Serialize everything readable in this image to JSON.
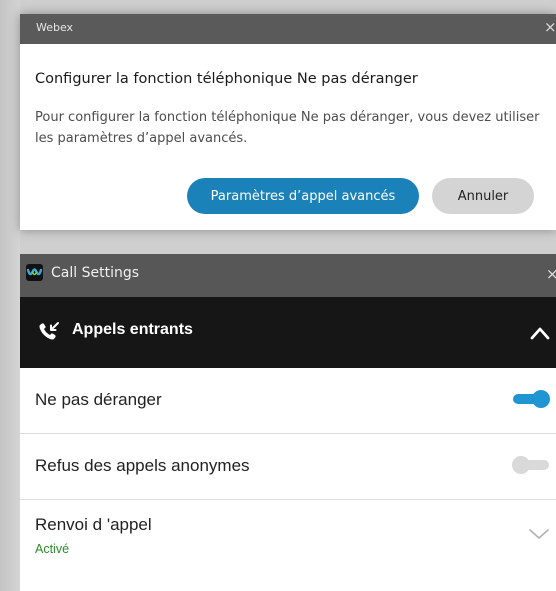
{
  "dialog": {
    "app_name": "Webex",
    "close_glyph": "×",
    "heading": "Configurer la fonction téléphonique Ne pas déranger",
    "message": "Pour configurer la fonction téléphonique Ne pas déranger, vous devez utiliser les paramètres d’appel avancés.",
    "primary_button": "Paramètres d’appel avancés",
    "secondary_button": "Annuler",
    "colors": {
      "primary": "#1a82b8",
      "secondary": "#d4d4d4",
      "titlebar": "#5a5a5a"
    }
  },
  "panel": {
    "title": "Call Settings",
    "close_glyph": "×",
    "section": {
      "title": "Appels entrants",
      "icon": "incoming-call-icon",
      "expanded": true
    },
    "rows": [
      {
        "label": "Ne pas déranger",
        "control": "toggle",
        "on": true
      },
      {
        "label": "Refus des appels anonymes",
        "control": "toggle",
        "on": false
      },
      {
        "label": "Renvoi d 'appel",
        "status": "Activé",
        "control": "chevron-down"
      }
    ],
    "colors": {
      "toggle_on": "#1f95d2",
      "toggle_off": "#d9d9d9",
      "status_green": "#2c8a2c",
      "header_bg": "#161616"
    }
  }
}
